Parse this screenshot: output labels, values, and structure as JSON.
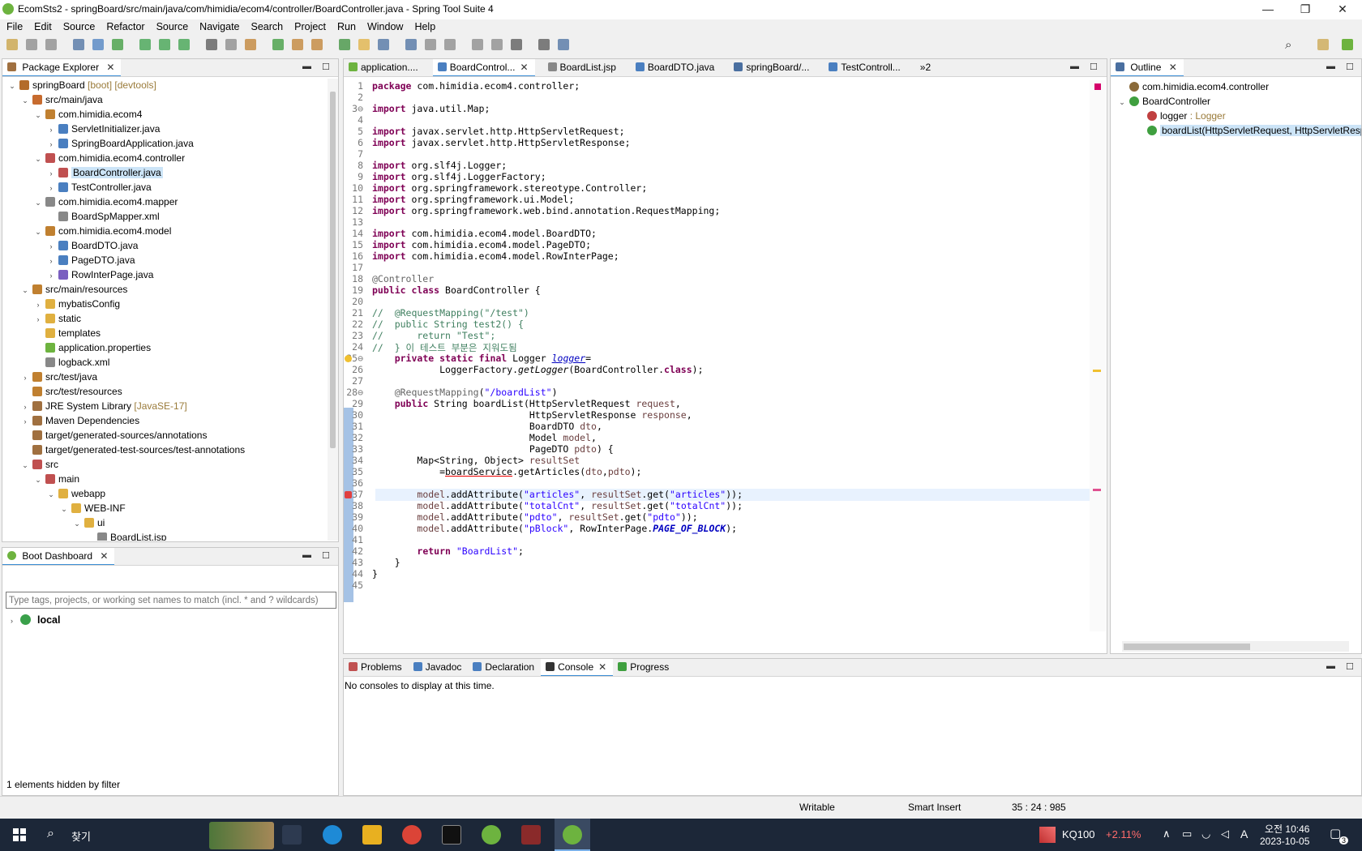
{
  "window": {
    "title": "EcomSts2 - springBoard/src/main/java/com/himidia/ecom4/controller/BoardController.java - Spring Tool Suite 4",
    "controls": [
      "—",
      "❐",
      "✕"
    ]
  },
  "menu": [
    "File",
    "Edit",
    "Source",
    "Refactor",
    "Source",
    "Navigate",
    "Search",
    "Project",
    "Run",
    "Window",
    "Help"
  ],
  "package_explorer": {
    "title": "Package Explorer",
    "rows": [
      {
        "label": "springBoard",
        "deco": " [boot] [devtools]",
        "indent": 0,
        "tw": "v",
        "icon": "#b36b2a"
      },
      {
        "label": "src/main/java",
        "deco": "",
        "indent": 1,
        "tw": "v",
        "icon": "#c76b2e"
      },
      {
        "label": "com.himidia.ecom4",
        "deco": "",
        "indent": 2,
        "tw": "v",
        "icon": "#c08030"
      },
      {
        "label": "ServletInitializer.java",
        "deco": "",
        "indent": 3,
        "tw": ">",
        "icon": "#4a7fc0"
      },
      {
        "label": "SpringBoardApplication.java",
        "deco": "",
        "indent": 3,
        "tw": ">",
        "icon": "#4a7fc0"
      },
      {
        "label": "com.himidia.ecom4.controller",
        "deco": "",
        "indent": 2,
        "tw": "v",
        "icon": "#c05050"
      },
      {
        "label": "BoardController.java",
        "deco": "",
        "indent": 3,
        "tw": ">",
        "icon": "#c05050",
        "selected": true
      },
      {
        "label": "TestController.java",
        "deco": "",
        "indent": 3,
        "tw": ">",
        "icon": "#4a7fc0"
      },
      {
        "label": "com.himidia.ecom4.mapper",
        "deco": "",
        "indent": 2,
        "tw": "v",
        "icon": "#888"
      },
      {
        "label": "BoardSpMapper.xml",
        "deco": "",
        "indent": 3,
        "tw": "",
        "icon": "#888"
      },
      {
        "label": "com.himidia.ecom4.model",
        "deco": "",
        "indent": 2,
        "tw": "v",
        "icon": "#c08030"
      },
      {
        "label": "BoardDTO.java",
        "deco": "",
        "indent": 3,
        "tw": ">",
        "icon": "#4a7fc0"
      },
      {
        "label": "PageDTO.java",
        "deco": "",
        "indent": 3,
        "tw": ">",
        "icon": "#4a7fc0"
      },
      {
        "label": "RowInterPage.java",
        "deco": "",
        "indent": 3,
        "tw": ">",
        "icon": "#7a5fc0"
      },
      {
        "label": "src/main/resources",
        "deco": "",
        "indent": 1,
        "tw": "v",
        "icon": "#c08030"
      },
      {
        "label": "mybatisConfig",
        "deco": "",
        "indent": 2,
        "tw": ">",
        "icon": "#e0b040"
      },
      {
        "label": "static",
        "deco": "",
        "indent": 2,
        "tw": ">",
        "icon": "#e0b040"
      },
      {
        "label": "templates",
        "deco": "",
        "indent": 2,
        "tw": "",
        "icon": "#e0b040"
      },
      {
        "label": "application.properties",
        "deco": "",
        "indent": 2,
        "tw": "",
        "icon": "#6db33f"
      },
      {
        "label": "logback.xml",
        "deco": "",
        "indent": 2,
        "tw": "",
        "icon": "#888"
      },
      {
        "label": "src/test/java",
        "deco": "",
        "indent": 1,
        "tw": ">",
        "icon": "#c08030"
      },
      {
        "label": "src/test/resources",
        "deco": "",
        "indent": 1,
        "tw": "",
        "icon": "#c08030"
      },
      {
        "label": "JRE System Library",
        "deco": " [JavaSE-17]",
        "indent": 1,
        "tw": ">",
        "icon": "#a07040"
      },
      {
        "label": "Maven Dependencies",
        "deco": "",
        "indent": 1,
        "tw": ">",
        "icon": "#a07040"
      },
      {
        "label": "target/generated-sources/annotations",
        "deco": "",
        "indent": 1,
        "tw": "",
        "icon": "#a07040"
      },
      {
        "label": "target/generated-test-sources/test-annotations",
        "deco": "",
        "indent": 1,
        "tw": "",
        "icon": "#a07040"
      },
      {
        "label": "src",
        "deco": "",
        "indent": 1,
        "tw": "v",
        "icon": "#c05050"
      },
      {
        "label": "main",
        "deco": "",
        "indent": 2,
        "tw": "v",
        "icon": "#c05050"
      },
      {
        "label": "webapp",
        "deco": "",
        "indent": 3,
        "tw": "v",
        "icon": "#e0b040"
      },
      {
        "label": "WEB-INF",
        "deco": "",
        "indent": 4,
        "tw": "v",
        "icon": "#e0b040"
      },
      {
        "label": "ui",
        "deco": "",
        "indent": 5,
        "tw": "v",
        "icon": "#e0b040"
      },
      {
        "label": "BoardList.jsp",
        "deco": "",
        "indent": 6,
        "tw": "",
        "icon": "#888"
      }
    ]
  },
  "boot_dashboard": {
    "title": "Boot Dashboard",
    "filter_placeholder": "Type tags, projects, or working set names to match (incl. * and ? wildcards)",
    "items": [
      {
        "label": "local"
      }
    ],
    "footer": "1 elements hidden by filter"
  },
  "editor_tabs": [
    {
      "label": "application....",
      "icon": "#6db33f",
      "active": false
    },
    {
      "label": "BoardControl...",
      "icon": "#4a7fc0",
      "active": true,
      "close": "✕"
    },
    {
      "label": "BoardList.jsp",
      "icon": "#888",
      "active": false
    },
    {
      "label": "BoardDTO.java",
      "icon": "#4a7fc0",
      "active": false
    },
    {
      "label": "springBoard/...",
      "icon": "#4a6fa0",
      "active": false
    },
    {
      "label": "TestControll...",
      "icon": "#4a7fc0",
      "active": false
    },
    {
      "label": "»2",
      "icon": "",
      "active": false
    }
  ],
  "code": [
    {
      "n": "1",
      "html": "<span class=\"kw\">package</span> com.himidia.ecom4.controller;"
    },
    {
      "n": "2",
      "html": ""
    },
    {
      "n": "3⊖",
      "html": "<span class=\"kw\">import</span> java.util.Map;"
    },
    {
      "n": "4",
      "html": ""
    },
    {
      "n": "5",
      "html": "<span class=\"kw\">import</span> javax.servlet.http.HttpServletRequest;"
    },
    {
      "n": "6",
      "html": "<span class=\"kw\">import</span> javax.servlet.http.HttpServletResponse;"
    },
    {
      "n": "7",
      "html": ""
    },
    {
      "n": "8",
      "html": "<span class=\"kw\">import</span> org.slf4j.Logger;"
    },
    {
      "n": "9",
      "html": "<span class=\"kw\">import</span> org.slf4j.LoggerFactory;"
    },
    {
      "n": "10",
      "html": "<span class=\"kw\">import</span> org.springframework.stereotype.Controller;"
    },
    {
      "n": "11",
      "html": "<span class=\"kw\">import</span> org.springframework.ui.Model;"
    },
    {
      "n": "12",
      "html": "<span class=\"kw\">import</span> org.springframework.web.bind.annotation.RequestMapping;"
    },
    {
      "n": "13",
      "html": ""
    },
    {
      "n": "14",
      "html": "<span class=\"kw\">import</span> com.himidia.ecom4.model.BoardDTO;"
    },
    {
      "n": "15",
      "html": "<span class=\"kw\">import</span> com.himidia.ecom4.model.PageDTO;"
    },
    {
      "n": "16",
      "html": "<span class=\"kw\">import</span> com.himidia.ecom4.model.RowInterPage;"
    },
    {
      "n": "17",
      "html": ""
    },
    {
      "n": "18",
      "html": "<span class=\"ann\">@Controller</span>"
    },
    {
      "n": "19",
      "html": "<span class=\"kw\">public</span> <span class=\"kw\">class</span> BoardController {"
    },
    {
      "n": "20",
      "html": ""
    },
    {
      "n": "21",
      "html": "<span class=\"cm\">//  @RequestMapping(\"/test\")</span>"
    },
    {
      "n": "22",
      "html": "<span class=\"cm\">//  public String test2() {</span>"
    },
    {
      "n": "23",
      "html": "<span class=\"cm\">//      return \"Test\";</span>"
    },
    {
      "n": "24",
      "html": "<span class=\"cm\">//  } 이 테스트 부분은 지워도됨</span>"
    },
    {
      "n": "25⊖",
      "html": "    <span class=\"kw\">private</span> <span class=\"kw\">static</span> <span class=\"kw\">final</span> Logger <span class=\"fld\"><u>logger</u></span>="
    },
    {
      "n": "26",
      "html": "            LoggerFactory.<i>getLogger</i>(BoardController.<span class=\"kw\">class</span>);"
    },
    {
      "n": "27",
      "html": ""
    },
    {
      "n": "28⊖",
      "html": "    <span class=\"ann\">@RequestMapping</span>(<span class=\"str\">\"/boardList\"</span>)"
    },
    {
      "n": "29",
      "html": "    <span class=\"kw\">public</span> String boardList(HttpServletRequest <span class=\"var\">request</span>,"
    },
    {
      "n": "30",
      "html": "                            HttpServletResponse <span class=\"var\">response</span>,"
    },
    {
      "n": "31",
      "html": "                            BoardDTO <span class=\"var\">dto</span>,"
    },
    {
      "n": "32",
      "html": "                            Model <span class=\"var\">model</span>,"
    },
    {
      "n": "33",
      "html": "                            PageDTO <span class=\"var\">pdto</span>) {"
    },
    {
      "n": "34",
      "html": "        Map&lt;String, Object&gt; <span class=\"var\">resultSet</span>"
    },
    {
      "n": "35",
      "html": "            =<u style=\"text-decoration-color:#e00\">boardService</u>.getArticles(<span class=\"var\">dto</span>,<span class=\"var\">pdto</span>);"
    },
    {
      "n": "36",
      "html": ""
    },
    {
      "n": "37",
      "html": "        <span class=\"var\">model</span>.addAttribute(<span class=\"str\">\"articles\"</span>, <span class=\"var\">resultSet</span>.get(<span class=\"str\">\"articles\"</span>));"
    },
    {
      "n": "38",
      "html": "        <span class=\"var\">model</span>.addAttribute(<span class=\"str\">\"totalCnt\"</span>, <span class=\"var\">resultSet</span>.get(<span class=\"str\">\"totalCnt\"</span>));"
    },
    {
      "n": "39",
      "html": "        <span class=\"var\">model</span>.addAttribute(<span class=\"str\">\"pdto\"</span>, <span class=\"var\">resultSet</span>.get(<span class=\"str\">\"pdto\"</span>));"
    },
    {
      "n": "40",
      "html": "        <span class=\"var\">model</span>.addAttribute(<span class=\"str\">\"pBlock\"</span>, RowInterPage.<span class=\"fld\" style=\"font-weight:bold\">PAGE_OF_BLOCK</span>);"
    },
    {
      "n": "41",
      "html": ""
    },
    {
      "n": "42",
      "html": "        <span class=\"kw\">return</span> <span class=\"str\">\"BoardList\"</span>;"
    },
    {
      "n": "43",
      "html": "    }"
    },
    {
      "n": "44",
      "html": "}"
    },
    {
      "n": "45",
      "html": ""
    }
  ],
  "outline": {
    "title": "Outline",
    "rows": [
      {
        "label": "com.himidia.ecom4.controller",
        "extra": "",
        "indent": 0,
        "icon": "#8a6a3a"
      },
      {
        "label": "BoardController",
        "extra": "",
        "indent": 0,
        "icon": "#3f9f3f",
        "tw": "v"
      },
      {
        "label": "logger",
        "extra": " : Logger",
        "indent": 1,
        "icon": "#c04040"
      },
      {
        "label": "boardList(HttpServletRequest, HttpServletResponse, BoardDTO, Model, PageDTO) : String",
        "extra": "",
        "indent": 1,
        "icon": "#3f9f3f",
        "selected": true
      }
    ]
  },
  "bottom_tabs": [
    {
      "label": "Problems",
      "icon": "#c05050",
      "active": false
    },
    {
      "label": "Javadoc",
      "icon": "#4a7fc0",
      "active": false
    },
    {
      "label": "Declaration",
      "icon": "#4a7fc0",
      "active": false
    },
    {
      "label": "Console",
      "icon": "#333",
      "active": true,
      "close": "✕"
    },
    {
      "label": "Progress",
      "icon": "#3f9f3f",
      "active": false
    }
  ],
  "console_message": "No consoles to display at this time.",
  "status": {
    "writable": "Writable",
    "insert_mode": "Smart Insert",
    "position": "35 : 24 : 985"
  },
  "taskbar": {
    "search_label": "찾기",
    "stock_name": "KQ100",
    "stock_change": "+2.11%",
    "time": "오전 10:46",
    "date": "2023-10-05",
    "ime": "A",
    "notif": "3"
  },
  "colors": {
    "accent": "#3c8fd6",
    "selection": "#cce4f7",
    "stock_up": "#ff6b6b"
  }
}
